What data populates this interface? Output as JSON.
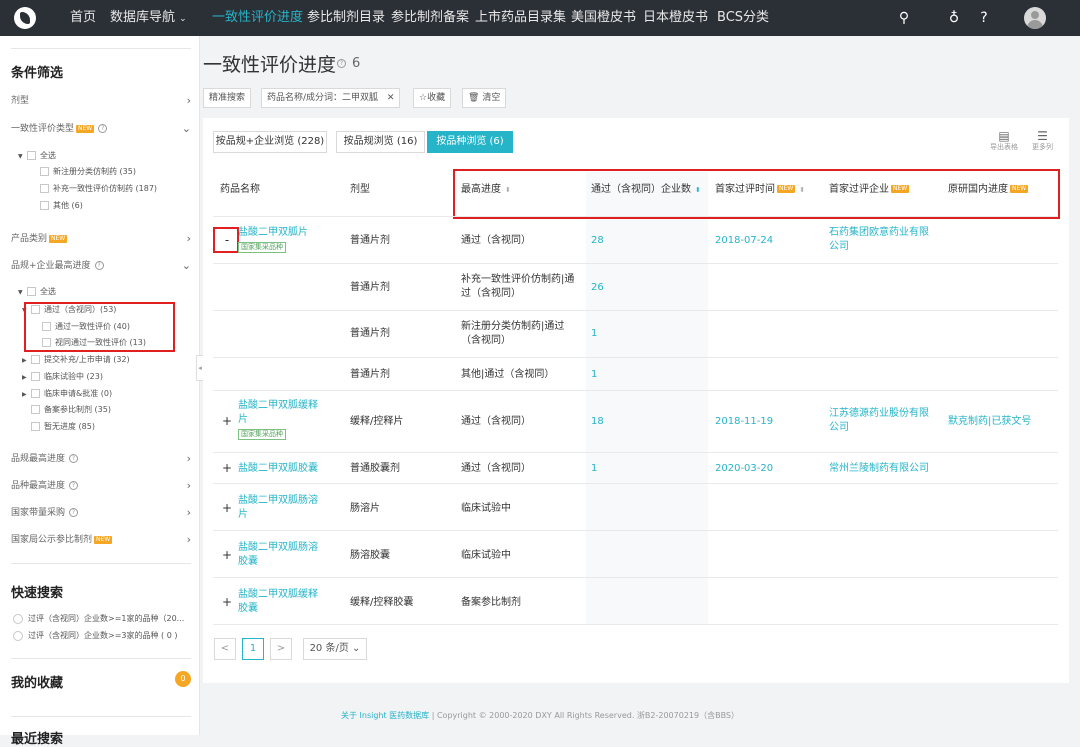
{
  "nav": {
    "items": [
      "首页",
      "数据库导航",
      "一致性评价进度",
      "参比制剂目录",
      "参比制剂备案",
      "上市药品目录集",
      "美国橙皮书",
      "日本橙皮书",
      "BCS分类"
    ],
    "active": "一致性评价进度",
    "icons": [
      "search-icon",
      "bulb-icon",
      "help-icon",
      "avatar"
    ]
  },
  "sidebar": {
    "title": "条件筛选",
    "dosage": "剂型",
    "eval_type": "一致性评价类型",
    "eval_type_options": [
      "全选",
      "新注册分类仿制药 (35)",
      "补充一致性评价仿制药 (187)",
      "其他 (6)"
    ],
    "product_category": "产品类别",
    "highest_progress": "品规+企业最高进度",
    "progress_tree": {
      "all": "全选",
      "passed": "通过（含视同）(53)",
      "passed_children": [
        "通过一致性评价 (40)",
        "视同通过一致性评价 (13)"
      ],
      "others": [
        "提交补充/上市申请 (32)",
        "临床试验中 (23)",
        "临床申请&批准 (0)",
        "备案参比制剂 (35)",
        "暂无进度 (85)"
      ]
    },
    "filters_more": [
      "品规最高进度",
      "品种最高进度",
      "国家带量采购",
      "国家局公示参比制剂"
    ],
    "new_tag": "NEW",
    "quick_search_title": "快速搜索",
    "quick_search": [
      "过评（含视同）企业数>=1家的品种（20...",
      "过评（含视同）企业数>=3家的品种 ( 0 )"
    ],
    "favorites_title": "我的收藏",
    "favorites_count": "0",
    "recent_title": "最近搜索"
  },
  "main": {
    "title": "一致性评价进度",
    "count": "6",
    "chips": [
      "精准搜索",
      "药品名称/成分词：二甲双胍",
      "☆收藏",
      "清空"
    ],
    "tabs": [
      "按品规+企业浏览 (228)",
      "按品规浏览 (16)",
      "按品种浏览 (6)"
    ],
    "active_tab": "按品种浏览 (6)",
    "view_buttons": [
      "导出表格",
      "更多列"
    ],
    "columns": [
      "药品名称",
      "剂型",
      "最高进度",
      "通过（含视同）企业数",
      "首家过评时间",
      "首家过评企业",
      "原研国内进度"
    ],
    "collect_tag": "国家集采品种",
    "rows": [
      {
        "expander": "-",
        "name": "盐酸二甲双胍片",
        "tag": "国家集采品种",
        "form": "普通片剂",
        "progress": "通过（含视同）",
        "count": "28",
        "date": "2018-07-24",
        "company": "石药集团欧意药业有限公司",
        "orig": ""
      },
      {
        "expander": "",
        "name": "",
        "tag": "",
        "form": "普通片剂",
        "progress": "补充一致性评价仿制药|通过（含视同）",
        "count": "26",
        "date": "",
        "company": "",
        "orig": ""
      },
      {
        "expander": "",
        "name": "",
        "tag": "",
        "form": "普通片剂",
        "progress": "新注册分类仿制药|通过（含视同）",
        "count": "1",
        "date": "",
        "company": "",
        "orig": ""
      },
      {
        "expander": "",
        "name": "",
        "tag": "",
        "form": "普通片剂",
        "progress": "其他|通过（含视同）",
        "count": "1",
        "date": "",
        "company": "",
        "orig": ""
      },
      {
        "expander": "+",
        "name": "盐酸二甲双胍缓释片",
        "tag": "国家集采品种",
        "form": "缓释/控释片",
        "progress": "通过（含视同）",
        "count": "18",
        "date": "2018-11-19",
        "company": "江苏德源药业股份有限公司",
        "orig": "默克制药|已获文号"
      },
      {
        "expander": "+",
        "name": "盐酸二甲双胍胶囊",
        "tag": "",
        "form": "普通胶囊剂",
        "progress": "通过（含视同）",
        "count": "1",
        "date": "2020-03-20",
        "company": "常州兰陵制药有限公司",
        "orig": ""
      },
      {
        "expander": "+",
        "name": "盐酸二甲双胍肠溶片",
        "tag": "",
        "form": "肠溶片",
        "progress": "临床试验中",
        "count": "",
        "date": "",
        "company": "",
        "orig": ""
      },
      {
        "expander": "+",
        "name": "盐酸二甲双胍肠溶胶囊",
        "tag": "",
        "form": "肠溶胶囊",
        "progress": "临床试验中",
        "count": "",
        "date": "",
        "company": "",
        "orig": ""
      },
      {
        "expander": "+",
        "name": "盐酸二甲双胍缓释胶囊",
        "tag": "",
        "form": "缓释/控释胶囊",
        "progress": "备案参比制剂",
        "count": "",
        "date": "",
        "company": "",
        "orig": ""
      }
    ],
    "pagination": {
      "prev": "<",
      "page": "1",
      "next": ">",
      "page_size": "20 条/页"
    }
  },
  "footer": {
    "link": "关于 Insight 医药数据库",
    "text": "|  Copyright © 2000-2020 DXY All Rights Reserved. 浙B2-20070219（含BBS）"
  }
}
